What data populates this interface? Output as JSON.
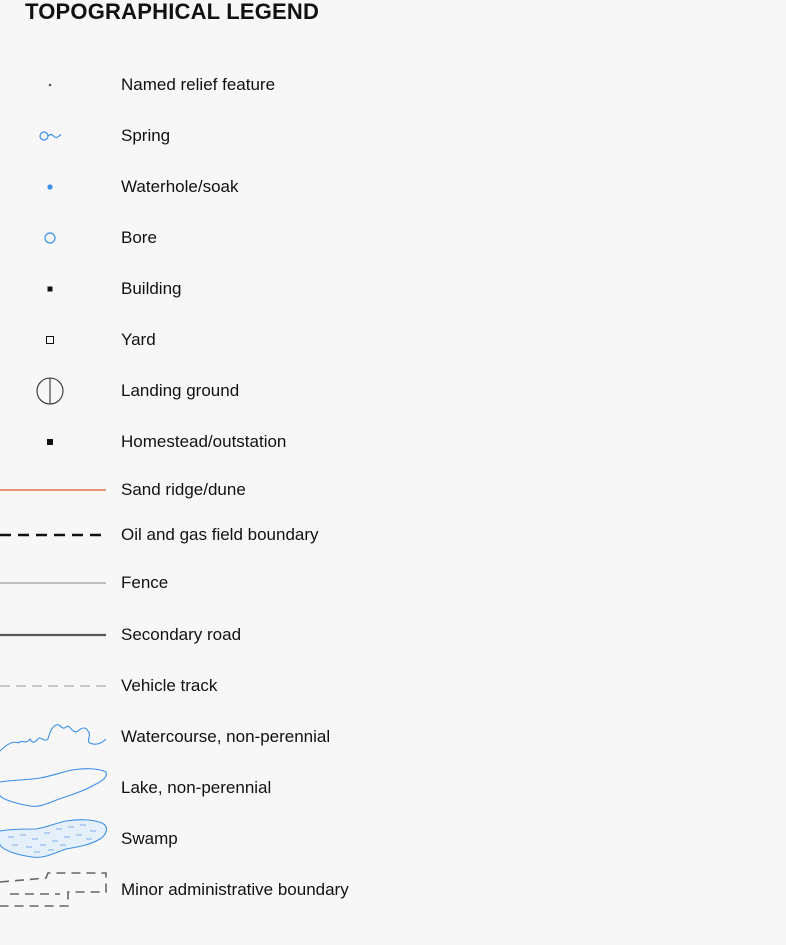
{
  "title": "TOPOGRAPHICAL LEGEND",
  "items": [
    {
      "label": "Named relief feature",
      "icon": "relief-point",
      "color": "#555555"
    },
    {
      "label": "Spring",
      "icon": "spring",
      "color": "#3b8fe8"
    },
    {
      "label": "Waterhole/soak",
      "icon": "waterhole",
      "color": "#3b8fe8"
    },
    {
      "label": "Bore",
      "icon": "bore",
      "color": "#3b8fe8"
    },
    {
      "label": "Building",
      "icon": "building",
      "color": "#111111"
    },
    {
      "label": "Yard",
      "icon": "yard",
      "color": "#111111"
    },
    {
      "label": "Landing ground",
      "icon": "landing-ground",
      "color": "#333333"
    },
    {
      "label": "Homestead/outstation",
      "icon": "homestead",
      "color": "#111111"
    },
    {
      "label": "Sand ridge/dune",
      "icon": "sand-ridge-line",
      "color": "#e0582a"
    },
    {
      "label": "Oil and gas field boundary",
      "icon": "oil-gas-boundary-line",
      "color": "#111111"
    },
    {
      "label": "Fence",
      "icon": "fence-line",
      "color": "#8a8a8a"
    },
    {
      "label": "Secondary road",
      "icon": "secondary-road-line",
      "color": "#555555"
    },
    {
      "label": "Vehicle track",
      "icon": "vehicle-track-line",
      "color": "#9a9a9a"
    },
    {
      "label": "Watercourse, non-perennial",
      "icon": "watercourse",
      "color": "#3b8fe8"
    },
    {
      "label": "Lake, non-perennial",
      "icon": "lake",
      "color": "#3b8fe8"
    },
    {
      "label": "Swamp",
      "icon": "swamp",
      "color": "#3b8fe8"
    },
    {
      "label": "Minor administrative boundary",
      "icon": "admin-boundary",
      "color": "#666666"
    }
  ]
}
